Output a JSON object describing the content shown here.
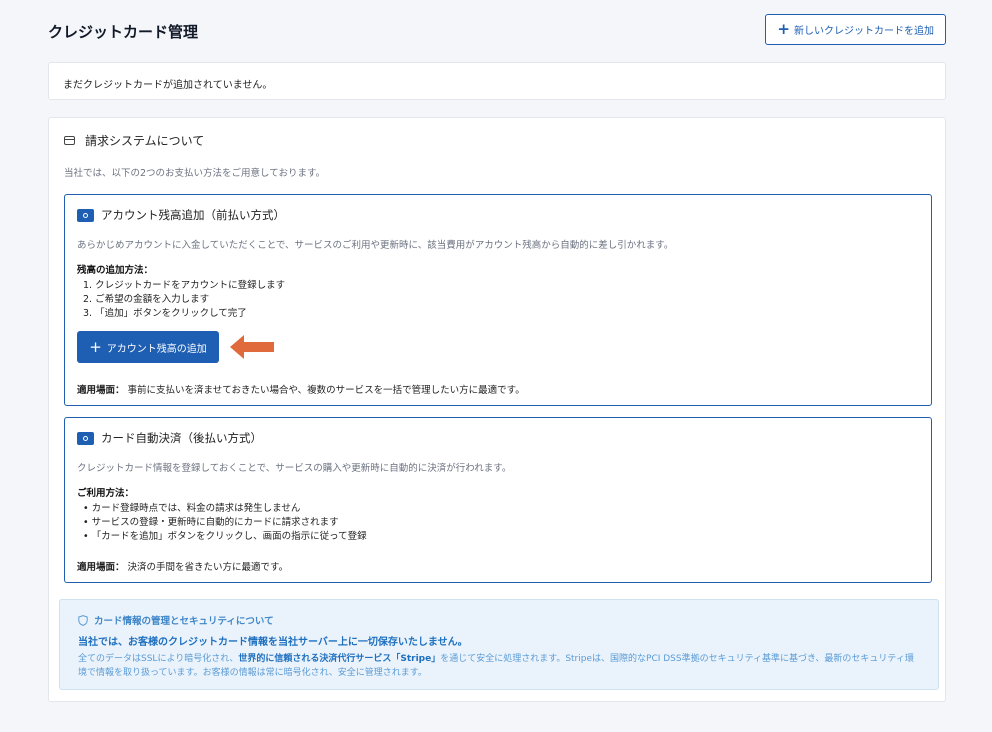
{
  "header": {
    "title": "クレジットカード管理",
    "add_button_label": "新しいクレジットカードを追加"
  },
  "empty_message": "まだクレジットカードが追加されていません。",
  "billing_info": {
    "title": "請求システムについて",
    "intro": "当社では、以下の2つのお支払い方法をご用意しております。",
    "method1": {
      "title": "アカウント残高追加（前払い方式）",
      "description": "あらかじめアカウントに入金していただくことで、サービスのご利用や更新時に、該当費用がアカウント残高から自動的に差し引かれます。",
      "subheading": "残高の追加方法：",
      "steps": [
        "1. クレジットカードをアカウントに登録します",
        "2. ご希望の金額を入力します",
        "3. 「追加」ボタンをクリックして完了"
      ],
      "button_label": "アカウント残高の追加",
      "note_label": "適用場面：",
      "note_text": " 事前に支払いを済ませておきたい場合や、複数のサービスを一括で管理したい方に最適です。"
    },
    "method2": {
      "title": "カード自動決済（後払い方式）",
      "description": "クレジットカード情報を登録しておくことで、サービスの購入や更新時に自動的に決済が行われます。",
      "subheading": "ご利用方法：",
      "steps": [
        "• カード登録時点では、料金の請求は発生しません",
        "• サービスの登録・更新時に自動的にカードに請求されます",
        "• 「カードを追加」ボタンをクリックし、画面の指示に従って登録"
      ],
      "note_label": "適用場面：",
      "note_text": " 決済の手間を省きたい方に最適です。"
    }
  },
  "security": {
    "title": "カード情報の管理とセキュリティについて",
    "strong_text": "当社では、お客様のクレジットカード情報を当社サーバー上に一切保存いたしません。",
    "body_part1": "全てのデータはSSLにより暗号化され、",
    "body_bold": "世界的に信頼される決済代行サービス「Stripe」",
    "body_part2": "を通じて安全に処理されます。Stripeは、国際的なPCI DSS準拠のセキュリティ基準に基づき、最新のセキュリティ環境で情報を取り扱っています。お客様の情報は常に暗号化され、安全に管理されます。"
  },
  "colors": {
    "primary": "#1e5fb3",
    "arrow": "#e06a3b",
    "security_bg": "#eaf3fb"
  }
}
